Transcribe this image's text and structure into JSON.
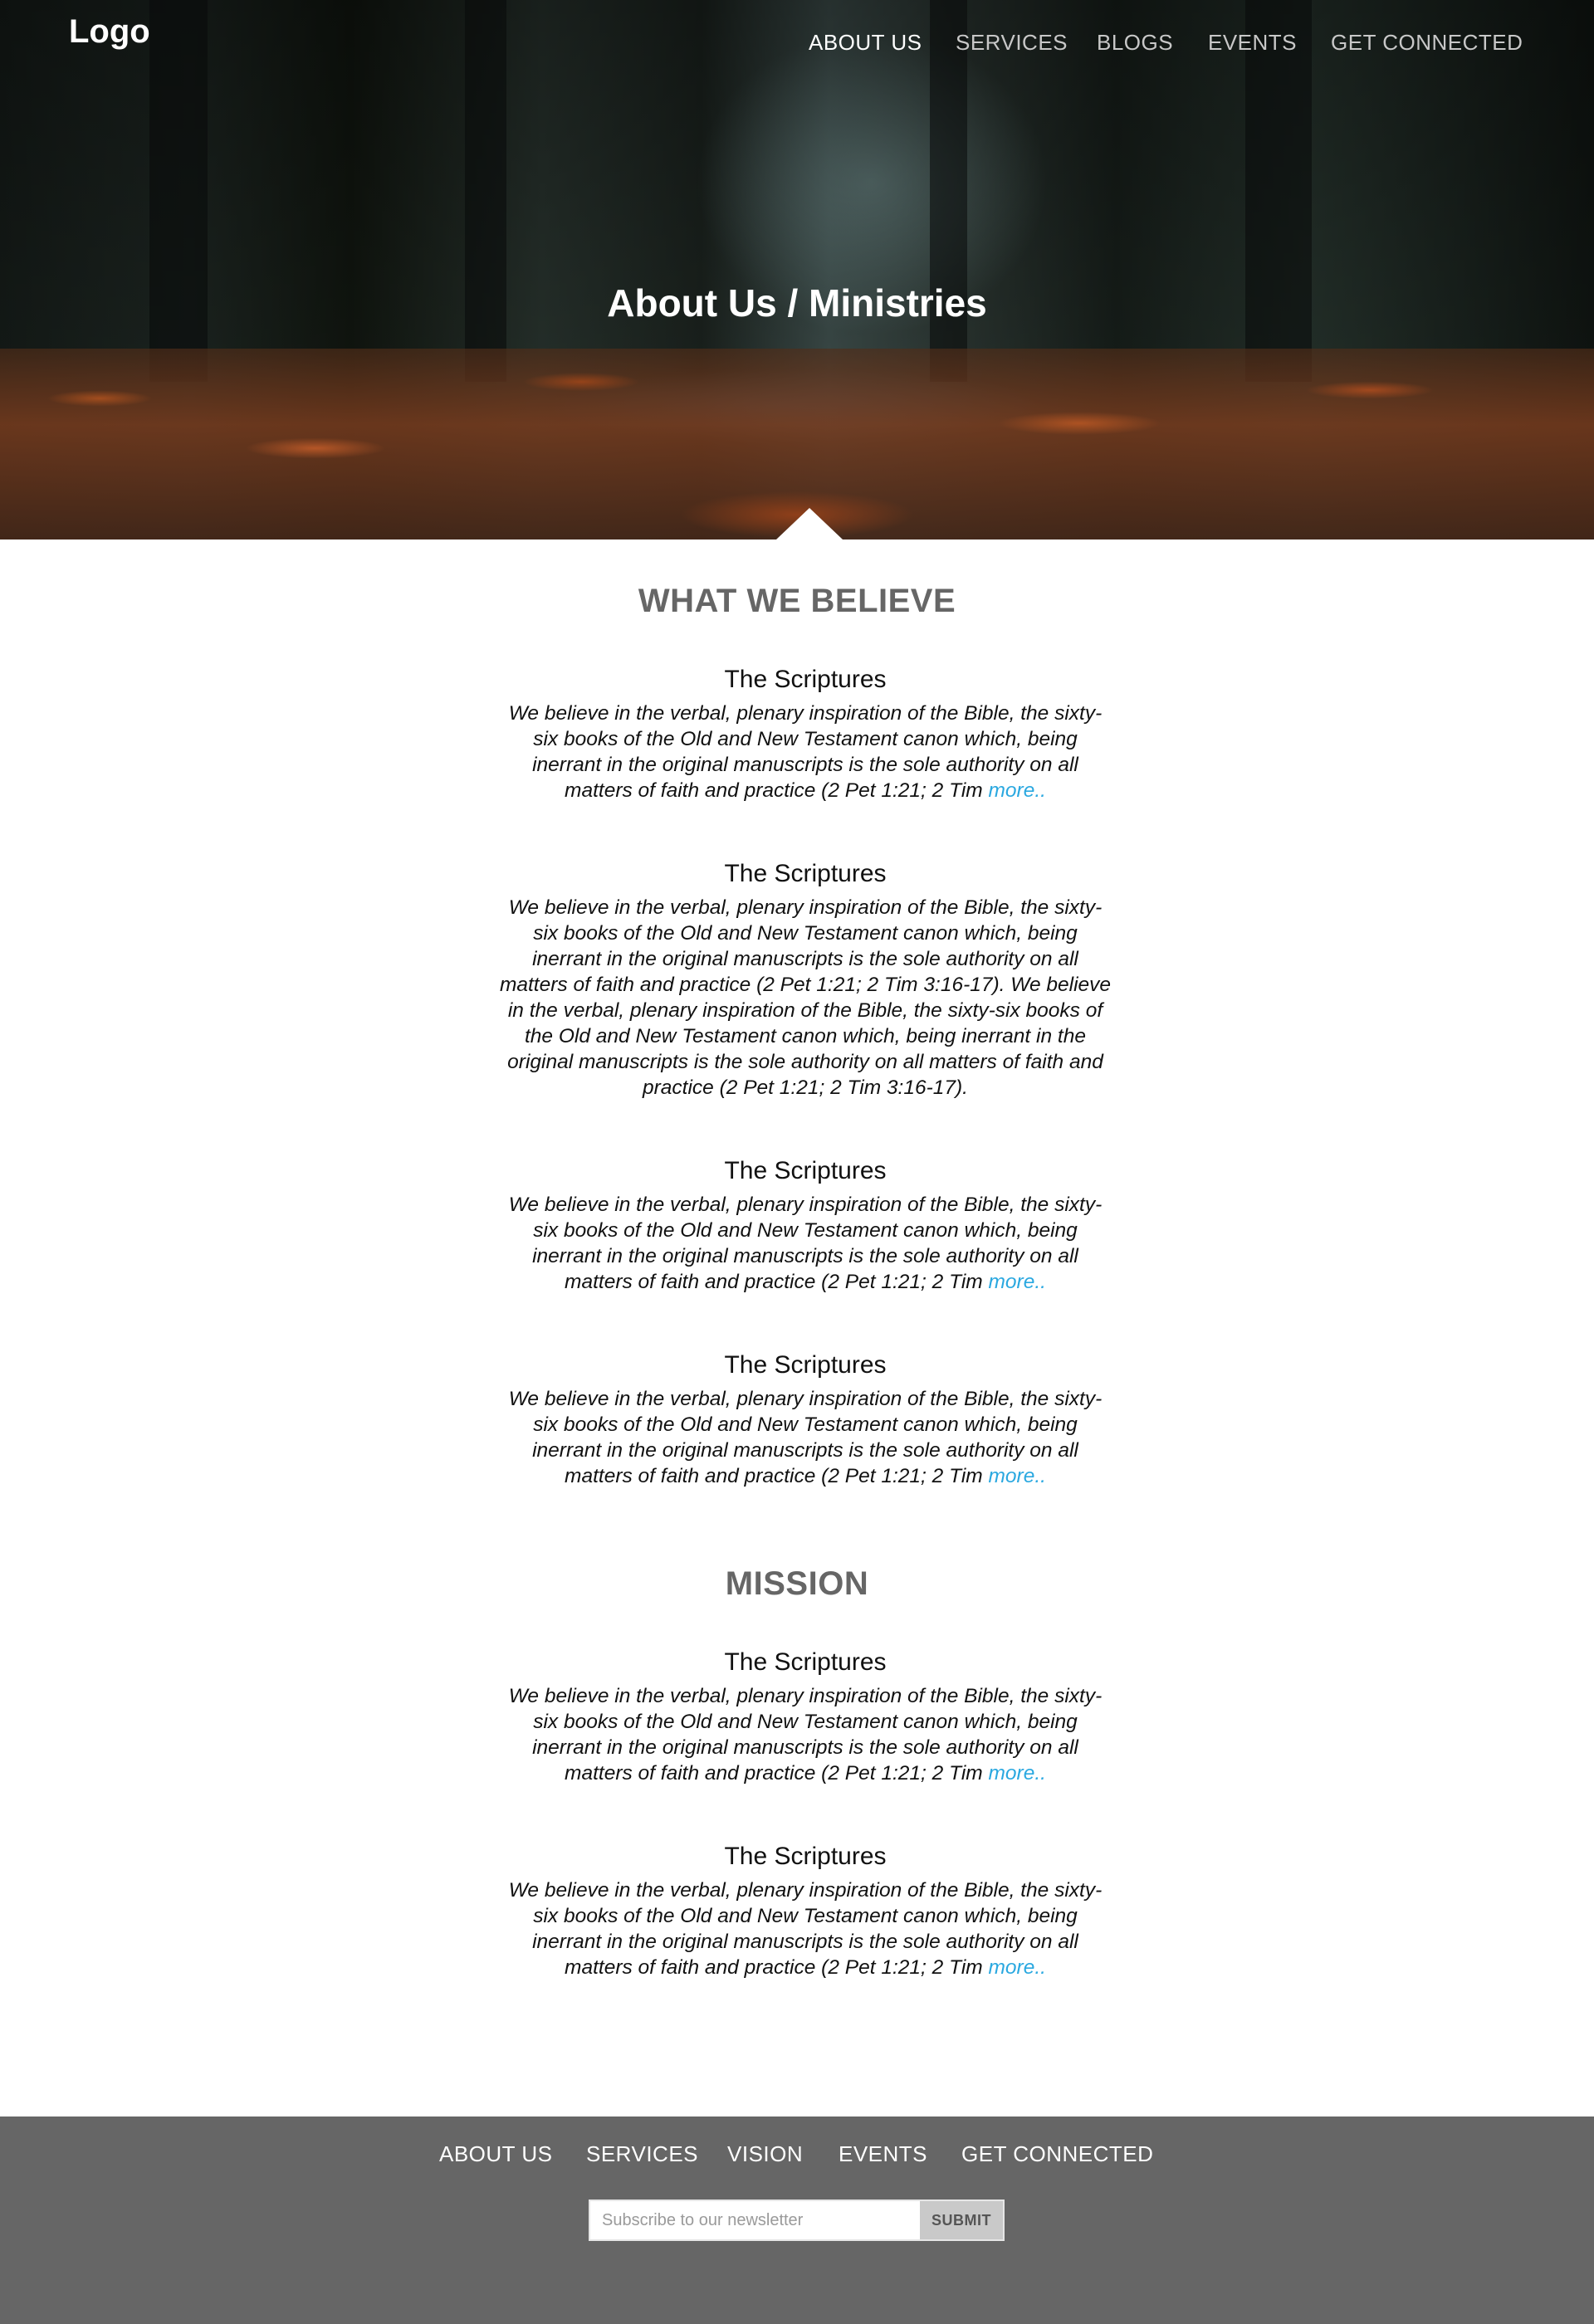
{
  "header": {
    "logo": "Logo",
    "nav": [
      {
        "label": "ABOUT US",
        "active": true
      },
      {
        "label": "SERVICES",
        "active": false
      },
      {
        "label": "BLOGS",
        "active": false
      },
      {
        "label": "EVENTS",
        "active": false
      },
      {
        "label": "GET CONNECTED",
        "active": false
      }
    ]
  },
  "hero": {
    "title": "About Us / Ministries"
  },
  "sections": [
    {
      "title": "WHAT WE BELIEVE",
      "items": [
        {
          "heading": "The Scriptures",
          "text": "We believe in the verbal, plenary inspiration of the Bible, the sixty-six books of the Old and New Testament canon which, being inerrant in the original manuscripts is the sole authority on all matters of faith and practice (2 Pet 1:21; 2 Tim",
          "more": "more.."
        },
        {
          "heading": "The Scriptures",
          "text": "We believe in the verbal, plenary inspiration of the Bible, the sixty-six books of the Old and New Testament canon which, being inerrant in the original manuscripts is the sole authority on all matters of faith and practice (2 Pet 1:21; 2 Tim 3:16-17). We believe in the verbal, plenary inspiration of the Bible, the sixty-six books of the Old and New Testament canon which, being inerrant in the original manuscripts is the sole authority on all matters of faith and practice (2 Pet 1:21; 2 Tim 3:16-17).",
          "more": ""
        },
        {
          "heading": "The Scriptures",
          "text": "We believe in the verbal, plenary inspiration of the Bible, the sixty-six books of the Old and New Testament canon which, being inerrant in the original manuscripts is the sole authority on all matters of faith and practice (2 Pet 1:21; 2 Tim",
          "more": "more.."
        },
        {
          "heading": "The Scriptures",
          "text": "We believe in the verbal, plenary inspiration of the Bible, the sixty-six books of the Old and New Testament canon which, being inerrant in the original manuscripts is the sole authority on all matters of faith and practice (2 Pet 1:21; 2 Tim",
          "more": "more.."
        }
      ]
    },
    {
      "title": "MISSION",
      "items": [
        {
          "heading": "The Scriptures",
          "text": "We believe in the verbal, plenary inspiration of the Bible, the sixty-six books of the Old and New Testament canon which, being inerrant in the original manuscripts is the sole authority on all matters of faith and practice (2 Pet 1:21; 2 Tim",
          "more": "more.."
        },
        {
          "heading": "The Scriptures",
          "text": "We believe in the verbal, plenary inspiration of the Bible, the sixty-six books of the Old and New Testament canon which, being inerrant in the original manuscripts is the sole authority on all matters of faith and practice (2 Pet 1:21; 2 Tim",
          "more": "more.."
        }
      ]
    }
  ],
  "footer": {
    "nav": [
      "ABOUT US",
      "SERVICES",
      "VISION",
      "EVENTS",
      "GET CONNECTED"
    ],
    "newsletter": {
      "placeholder": "Subscribe to our newsletter",
      "submit_label": "SUBMIT"
    }
  },
  "colors": {
    "link_more": "#2aa8e0",
    "section_title": "#666666",
    "footer_bg": "#666666"
  }
}
